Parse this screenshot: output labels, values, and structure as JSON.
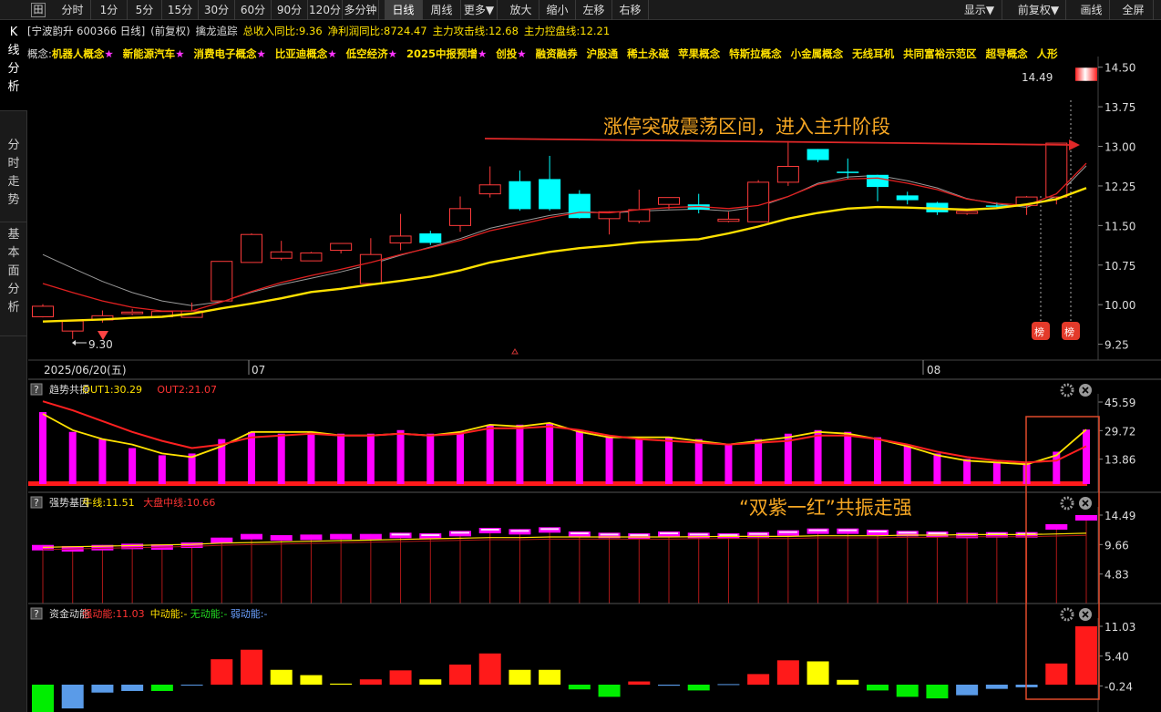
{
  "toolbar": {
    "logo": "田",
    "buttons": [
      "分时",
      "1分",
      "5分",
      "15分",
      "30分",
      "60分",
      "90分",
      "120分",
      "多分钟",
      "日线",
      "周线",
      "更多▼",
      "放大",
      "缩小",
      "左移",
      "右移"
    ],
    "active": "日线",
    "right_buttons": [
      "显示▼",
      "前复权▼",
      "画线",
      "全屏"
    ]
  },
  "left_tabs": [
    "K线分析",
    "分时走势",
    "基本面分析"
  ],
  "info": {
    "stock": "[宁波韵升 600366 日线]",
    "adjust": "(前复权)",
    "indicator": "擒龙追踪",
    "revenue_yoy": "总收入同比:9.36",
    "profit_yoy": "净利润同比:8724.47",
    "attack_line": "主力攻击线:12.68",
    "control_line": "主力控盘线:12.21"
  },
  "concepts": {
    "prefix": "概念:",
    "items": [
      "机器人概念★",
      "新能源汽车★",
      "消费电子概念★",
      "比亚迪概念★",
      "低空经济★",
      "2025中报预增★",
      "创投★",
      "融资融券",
      "沪股通",
      "稀土永磁",
      "苹果概念",
      "特斯拉概念",
      "小金属概念",
      "无线耳机",
      "共同富裕示范区",
      "超导概念",
      "人形"
    ]
  },
  "main_chart": {
    "price_ticks": [
      "14.50",
      "13.75",
      "13.00",
      "12.25",
      "11.50",
      "10.75",
      "10.00",
      "9.25"
    ],
    "date_labels": [
      "2025/06/20(五)",
      "07",
      "08"
    ],
    "high_label": "14.49",
    "low_label": "9.30",
    "bang_label": "榜",
    "annotation": "涨停突破震荡区间，进入主升阶段"
  },
  "panel1": {
    "title": "趋势共振",
    "out1": "OUT1:30.29",
    "out2": "OUT2:21.07",
    "ticks": [
      "45.59",
      "29.72",
      "13.86"
    ]
  },
  "panel2": {
    "title": "强势基因",
    "niu": "牛线:11.51",
    "dapan": "大盘中线:10.66",
    "ticks": [
      "14.49",
      "9.66",
      "4.83"
    ],
    "annotation": "“双紫一红”共振走强"
  },
  "panel3": {
    "title": "资金动能",
    "strong": "强动能:11.03",
    "mid": "中动能:-",
    "none": "无动能:-",
    "weak": "弱动能:-",
    "ticks": [
      "11.03",
      "5.40",
      "-0.24"
    ]
  },
  "colors": {
    "up": "#ff3b3b",
    "down": "#00ffff",
    "ma_yellow": "#ffe100",
    "magenta": "#ff00ff",
    "annotation": "#f5a623"
  },
  "chart_data": {
    "type": "candlestick",
    "candles": [
      {
        "o": 9.77,
        "c": 9.97,
        "h": 10.01,
        "l": 9.76
      },
      {
        "o": 9.5,
        "c": 9.69,
        "h": 9.69,
        "l": 9.35
      },
      {
        "o": 9.71,
        "c": 9.79,
        "h": 9.89,
        "l": 9.66
      },
      {
        "o": 9.83,
        "c": 9.86,
        "h": 9.92,
        "l": 9.8
      },
      {
        "o": 9.77,
        "c": 9.87,
        "h": 9.88,
        "l": 9.77
      },
      {
        "o": 9.76,
        "c": 9.88,
        "h": 10.04,
        "l": 9.76
      },
      {
        "o": 10.07,
        "c": 10.82,
        "h": 10.82,
        "l": 10.07
      },
      {
        "o": 10.8,
        "c": 11.33,
        "h": 11.35,
        "l": 10.8
      },
      {
        "o": 10.88,
        "c": 11.0,
        "h": 11.21,
        "l": 10.84
      },
      {
        "o": 10.83,
        "c": 10.98,
        "h": 11.0,
        "l": 10.83
      },
      {
        "o": 11.03,
        "c": 11.16,
        "h": 11.16,
        "l": 10.97
      },
      {
        "o": 10.4,
        "c": 10.95,
        "h": 11.26,
        "l": 10.4
      },
      {
        "o": 11.17,
        "c": 11.3,
        "h": 11.72,
        "l": 11.03
      },
      {
        "o": 11.35,
        "c": 11.17,
        "h": 11.4,
        "l": 11.13
      },
      {
        "o": 11.5,
        "c": 11.82,
        "h": 12.05,
        "l": 11.38
      },
      {
        "o": 12.1,
        "c": 12.27,
        "h": 12.62,
        "l": 12.03
      },
      {
        "o": 12.34,
        "c": 11.81,
        "h": 12.54,
        "l": 11.78
      },
      {
        "o": 12.38,
        "c": 11.81,
        "h": 12.82,
        "l": 11.78
      },
      {
        "o": 12.1,
        "c": 11.64,
        "h": 12.17,
        "l": 11.63
      },
      {
        "o": 11.63,
        "c": 11.76,
        "h": 11.77,
        "l": 11.33
      },
      {
        "o": 11.58,
        "c": 11.8,
        "h": 12.18,
        "l": 11.54
      },
      {
        "o": 11.9,
        "c": 12.03,
        "h": 12.03,
        "l": 11.81
      },
      {
        "o": 11.9,
        "c": 11.8,
        "h": 12.1,
        "l": 11.73
      },
      {
        "o": 11.58,
        "c": 11.62,
        "h": 11.76,
        "l": 11.56
      },
      {
        "o": 11.57,
        "c": 12.32,
        "h": 12.36,
        "l": 11.57
      },
      {
        "o": 12.32,
        "c": 12.62,
        "h": 13.1,
        "l": 12.25
      },
      {
        "o": 12.95,
        "c": 12.74,
        "h": 12.95,
        "l": 12.7
      },
      {
        "o": 12.52,
        "c": 12.5,
        "h": 12.77,
        "l": 12.38
      },
      {
        "o": 12.46,
        "c": 12.23,
        "h": 12.46,
        "l": 11.96
      },
      {
        "o": 12.07,
        "c": 11.98,
        "h": 12.14,
        "l": 11.9
      },
      {
        "o": 11.93,
        "c": 11.75,
        "h": 11.95,
        "l": 11.7
      },
      {
        "o": 11.73,
        "c": 11.77,
        "h": 11.78,
        "l": 11.7
      },
      {
        "o": 11.88,
        "c": 11.87,
        "h": 11.94,
        "l": 11.82
      },
      {
        "o": 11.88,
        "c": 12.04,
        "h": 12.06,
        "l": 11.7
      },
      {
        "o": 12.04,
        "c": 13.06,
        "h": 13.06,
        "l": 11.9
      },
      {
        "o": 14.24,
        "c": 14.49,
        "h": 14.49,
        "l": 14.24
      }
    ],
    "ma_red": [
      10.4,
      10.23,
      10.07,
      9.95,
      9.88,
      9.88,
      10.05,
      10.25,
      10.42,
      10.55,
      10.67,
      10.8,
      10.95,
      11.08,
      11.22,
      11.4,
      11.52,
      11.65,
      11.75,
      11.74,
      11.8,
      11.84,
      11.86,
      11.82,
      11.88,
      12.05,
      12.28,
      12.38,
      12.4,
      12.3,
      12.18,
      12.0,
      11.92,
      11.88,
      12.1,
      12.68
    ],
    "ma_yellow": [
      9.68,
      9.7,
      9.72,
      9.75,
      9.77,
      9.83,
      9.93,
      10.02,
      10.12,
      10.24,
      10.3,
      10.38,
      10.45,
      10.53,
      10.65,
      10.8,
      10.9,
      11.0,
      11.07,
      11.12,
      11.18,
      11.21,
      11.24,
      11.35,
      11.48,
      11.63,
      11.74,
      11.82,
      11.85,
      11.84,
      11.82,
      11.8,
      11.83,
      11.9,
      12.0,
      12.21
    ],
    "panel1_bars": [
      40,
      29,
      25,
      20,
      16,
      17,
      25,
      29,
      28,
      29,
      28,
      28,
      30,
      28,
      29,
      33,
      33,
      34,
      30,
      27,
      25,
      26,
      25,
      22,
      25,
      28,
      30,
      29,
      26,
      22,
      17,
      14,
      12,
      12,
      18,
      30.29
    ],
    "panel1_yellow": [
      39,
      30,
      25,
      22,
      17,
      15,
      21,
      29,
      29,
      29,
      27,
      27,
      28,
      27,
      29,
      33,
      32,
      34,
      29,
      26,
      26,
      26,
      24,
      22,
      24,
      26,
      29,
      28,
      25,
      21,
      16,
      13,
      12,
      11,
      16,
      30.29
    ],
    "panel1_red": [
      46,
      41,
      35,
      29,
      24,
      20,
      22,
      26,
      27,
      28,
      27,
      27,
      28,
      27,
      28,
      31,
      31,
      32,
      30,
      27,
      25,
      24,
      23,
      22,
      23,
      24,
      27,
      27,
      25,
      22,
      18,
      15,
      13,
      12,
      13,
      21.07
    ],
    "panel2_bars": [
      9.6,
      9.4,
      9.6,
      9.8,
      9.7,
      10.0,
      10.8,
      11.4,
      11.2,
      11.3,
      11.4,
      11.4,
      11.6,
      11.5,
      11.9,
      12.4,
      12.2,
      12.5,
      11.8,
      11.6,
      11.5,
      11.8,
      11.6,
      11.5,
      11.7,
      12.0,
      12.3,
      12.3,
      12.1,
      11.9,
      11.8,
      11.6,
      11.7,
      11.7,
      13.0,
      14.49
    ],
    "panel2_niu": [
      9.2,
      9.3,
      9.4,
      9.5,
      9.6,
      9.7,
      9.9,
      10.0,
      10.1,
      10.2,
      10.3,
      10.4,
      10.5,
      10.6,
      10.7,
      10.8,
      10.8,
      10.9,
      10.9,
      10.9,
      10.9,
      10.9,
      10.95,
      11.0,
      11.0,
      11.0,
      11.1,
      11.1,
      11.1,
      11.2,
      11.2,
      11.3,
      11.3,
      11.3,
      11.4,
      11.51
    ],
    "panel3_bars": [
      -5.5,
      -4.5,
      -1.5,
      -1.2,
      -1.2,
      -0.1,
      4.8,
      6.6,
      2.8,
      1.8,
      0.2,
      1.0,
      2.7,
      1.0,
      3.8,
      5.9,
      2.8,
      2.8,
      -0.9,
      -2.3,
      0.6,
      -0.2,
      -1.1,
      0.1,
      2.0,
      4.6,
      4.4,
      0.9,
      -1.1,
      -2.3,
      -2.6,
      -2.0,
      -0.8,
      -0.5,
      4.0,
      11.03
    ],
    "panel3_colors": [
      "green",
      "blue",
      "blue",
      "blue",
      "green",
      "blue",
      "red",
      "red",
      "yellow",
      "yellow",
      "yellow",
      "red",
      "red",
      "yellow",
      "red",
      "red",
      "yellow",
      "yellow",
      "green",
      "green",
      "red",
      "blue",
      "green",
      "blue",
      "red",
      "red",
      "yellow",
      "yellow",
      "green",
      "green",
      "green",
      "blue",
      "blue",
      "blue",
      "red",
      "red"
    ]
  }
}
